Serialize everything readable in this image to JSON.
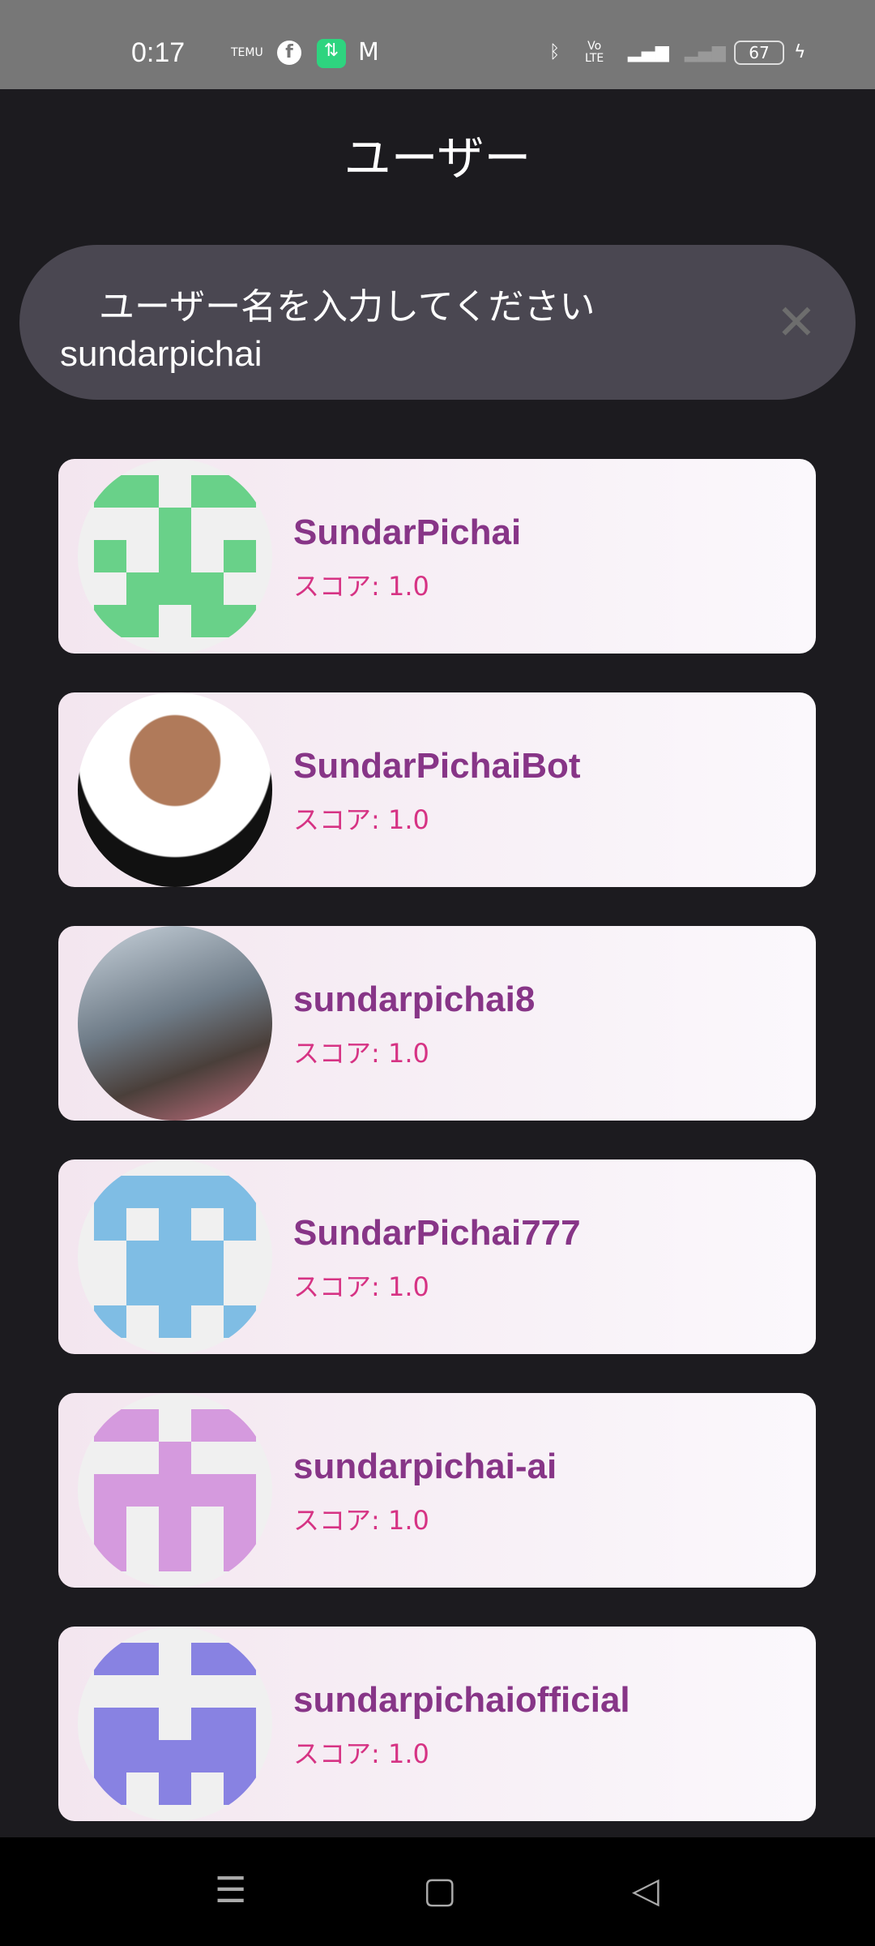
{
  "status_bar": {
    "time": "0:17",
    "battery": "67",
    "icons": [
      "temu-icon",
      "facebook-icon",
      "data-transfer-icon",
      "gmail-icon",
      "bluetooth-icon",
      "volte-icon",
      "4g-signal-icon",
      "no-signal-icon",
      "battery-icon",
      "charging-icon"
    ]
  },
  "header": {
    "title": "ユーザー"
  },
  "search": {
    "label": "ユーザー名を入力してください",
    "value": "sundarpichai"
  },
  "users": [
    {
      "name": "SundarPichai",
      "score": "スコア: 1.0",
      "avatar": "identicon",
      "color": "#69d189",
      "pattern": [
        "11011",
        "00100",
        "10101",
        "01110",
        "11011"
      ]
    },
    {
      "name": "SundarPichaiBot",
      "score": "スコア: 1.0",
      "avatar": "photo"
    },
    {
      "name": "sundarpichai8",
      "score": "スコア: 1.0",
      "avatar": "photo"
    },
    {
      "name": "SundarPichai777",
      "score": "スコア: 1.0",
      "avatar": "identicon",
      "color": "#7fbde4",
      "pattern": [
        "11111",
        "10101",
        "01110",
        "01110",
        "10101"
      ]
    },
    {
      "name": "sundarpichai-ai",
      "score": "スコア: 1.0",
      "avatar": "identicon",
      "color": "#d59ade",
      "pattern": [
        "11011",
        "00100",
        "11111",
        "10101",
        "10101"
      ]
    },
    {
      "name": "sundarpichaiofficial",
      "score": "スコア: 1.0",
      "avatar": "identicon",
      "color": "#8882e2",
      "pattern": [
        "11011",
        "00000",
        "11011",
        "11111",
        "10101"
      ]
    }
  ]
}
